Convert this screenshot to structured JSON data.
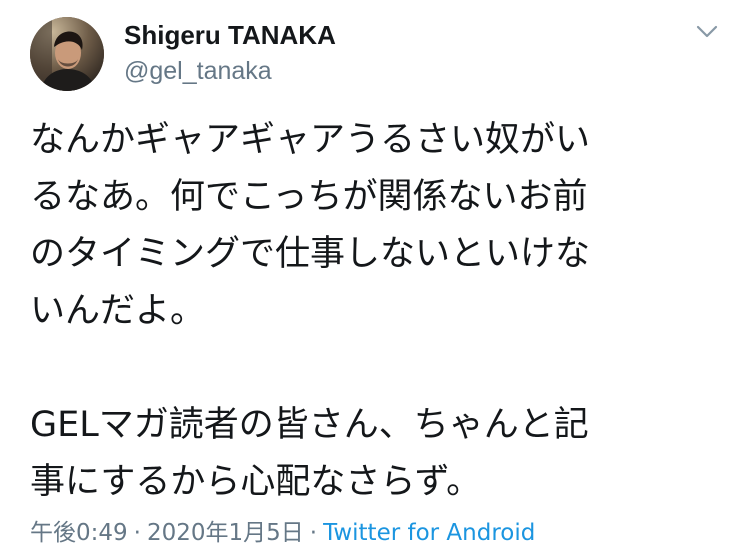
{
  "user": {
    "display_name": "Shigeru TANAKA",
    "handle": "@gel_tanaka"
  },
  "tweet": {
    "lines": [
      "なんかギャアギャアうるさい奴がい",
      "るなあ。何でこっちが関係ないお前",
      "のタイミングで仕事しないといけな",
      "いんだよ。",
      "GELマガ読者の皆さん、ちゃんと記",
      "事にするから心配なさらず。"
    ],
    "time": "午後0:49",
    "separator": "·",
    "date": "2020年1月5日",
    "source": "Twitter for Android"
  },
  "colors": {
    "text": "#14171a",
    "secondary": "#657786",
    "link": "#1b95e0"
  },
  "icons": {
    "caret": "chevron-down-icon",
    "avatar": "profile-photo"
  }
}
